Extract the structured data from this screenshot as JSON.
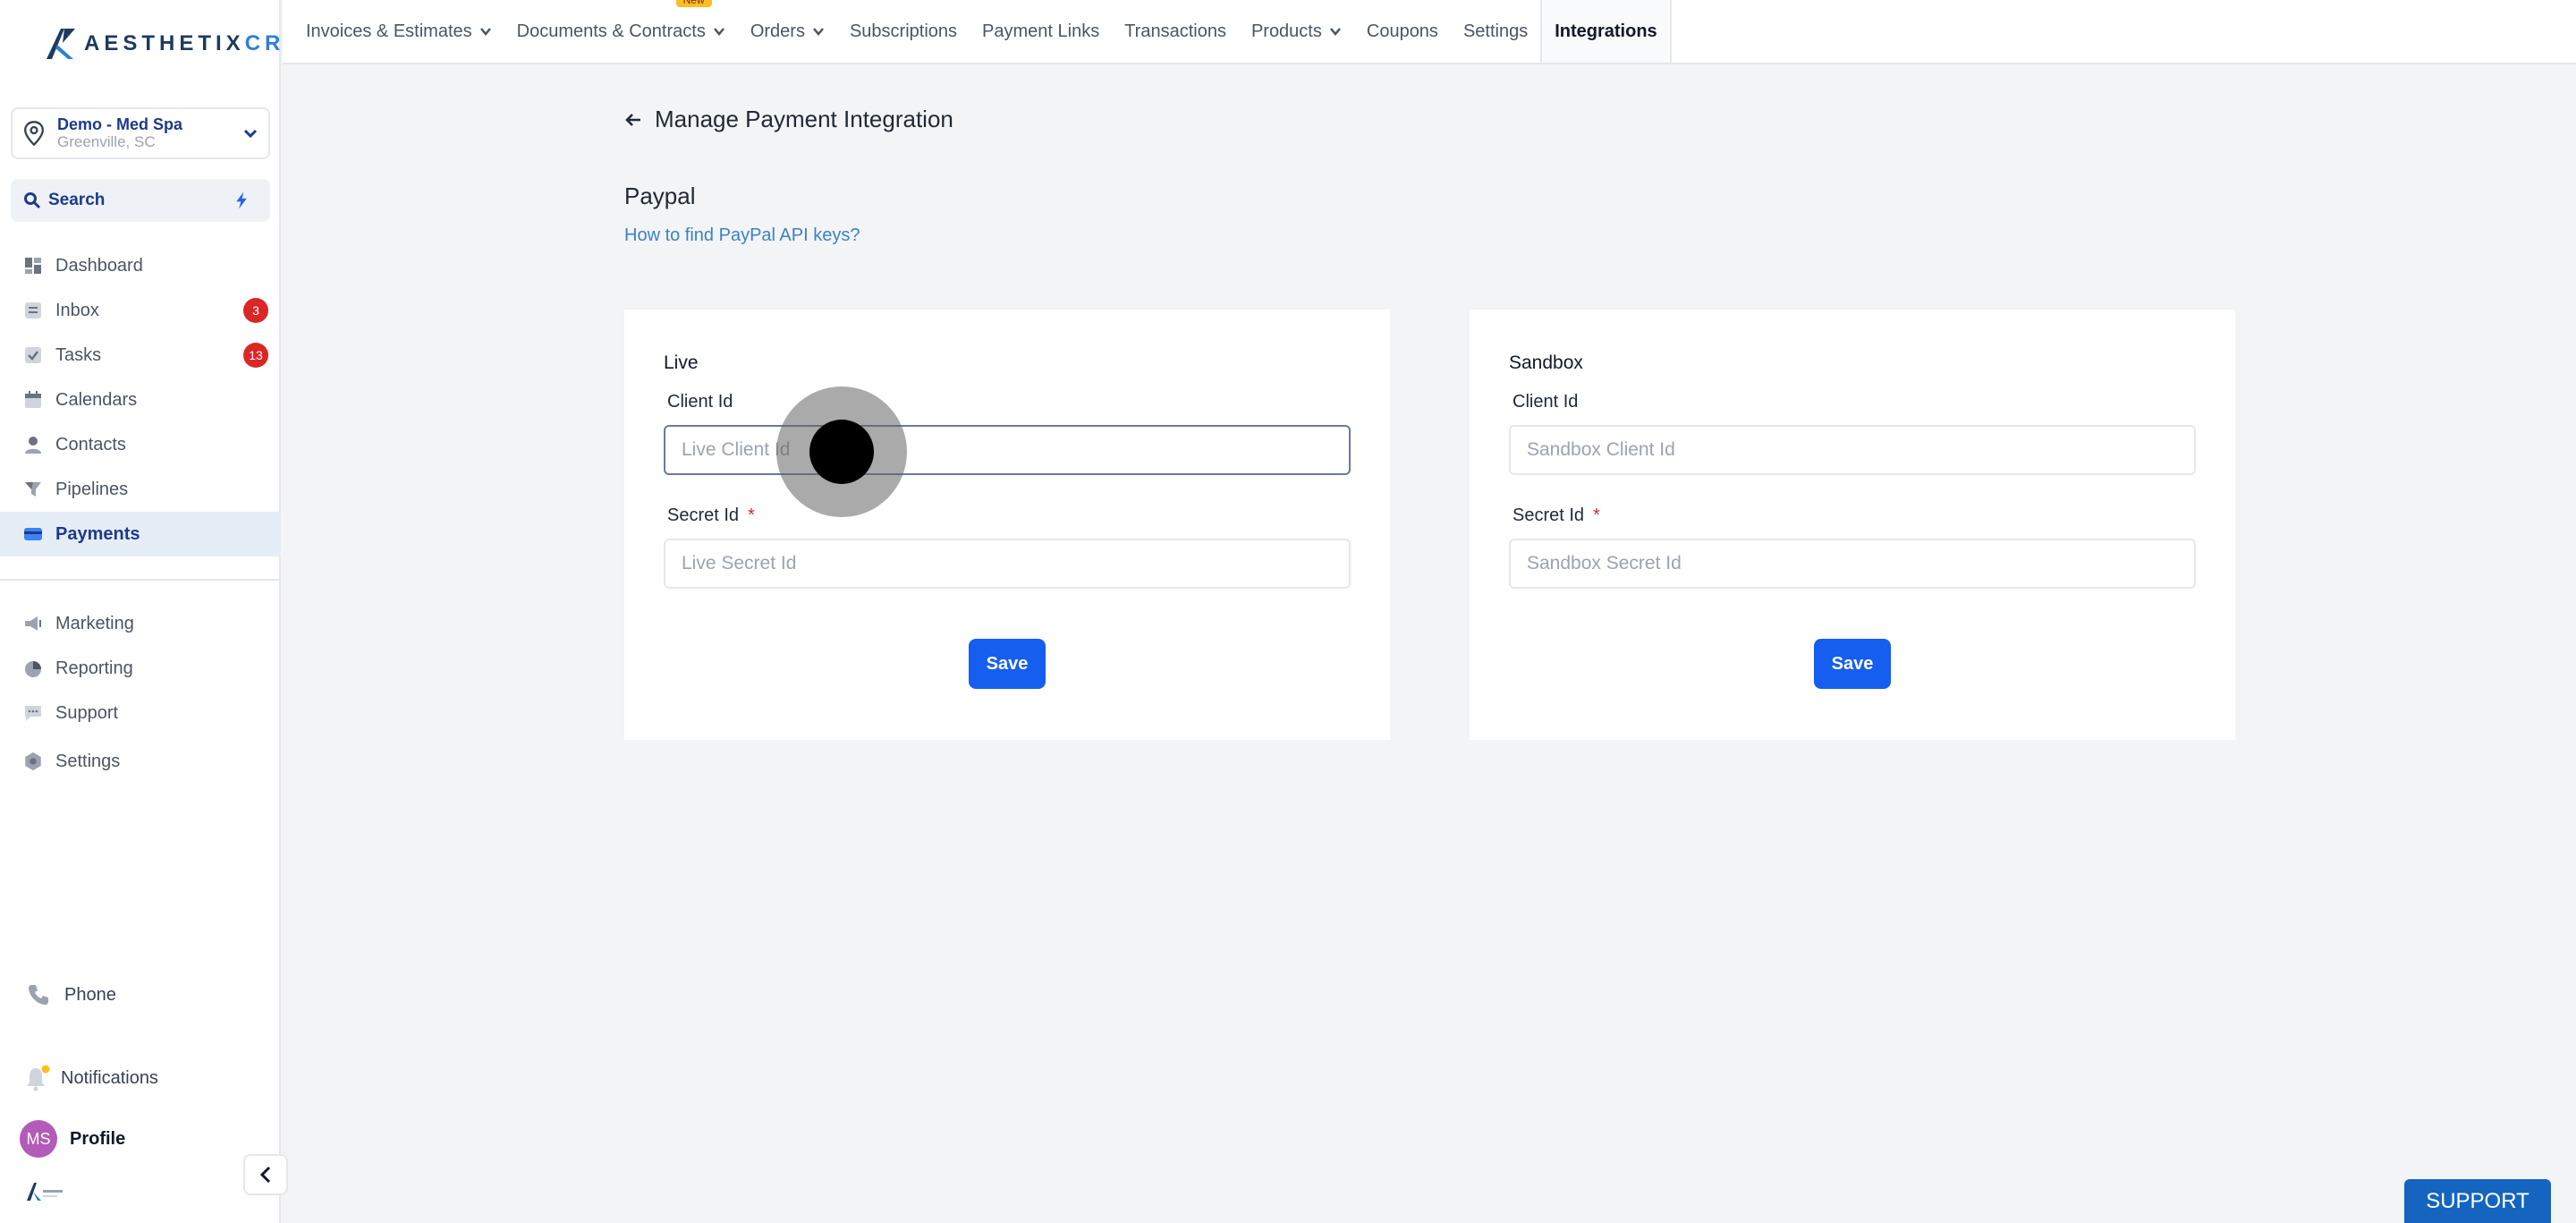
{
  "brand": {
    "name_part1": "AESTHETIX",
    "name_part2": "CRM"
  },
  "location": {
    "name": "Demo - Med Spa",
    "city": "Greenville, SC"
  },
  "search": {
    "label": "Search"
  },
  "sidebar": {
    "items": [
      {
        "label": "Dashboard",
        "icon": "dashboard-icon"
      },
      {
        "label": "Inbox",
        "icon": "inbox-icon",
        "badge": "3"
      },
      {
        "label": "Tasks",
        "icon": "tasks-icon",
        "badge": "13"
      },
      {
        "label": "Calendars",
        "icon": "calendar-icon"
      },
      {
        "label": "Contacts",
        "icon": "contacts-icon"
      },
      {
        "label": "Pipelines",
        "icon": "pipelines-icon"
      },
      {
        "label": "Payments",
        "icon": "payments-icon",
        "active": true
      }
    ],
    "items2": [
      {
        "label": "Marketing",
        "icon": "marketing-icon"
      },
      {
        "label": "Reporting",
        "icon": "reporting-icon"
      },
      {
        "label": "Support",
        "icon": "support-icon"
      },
      {
        "label": "Settings",
        "icon": "settings-icon"
      }
    ],
    "phone": "Phone",
    "notifications": "Notifications",
    "profile": {
      "initials": "MS",
      "label": "Profile"
    }
  },
  "topnav": {
    "new_badge": "New",
    "tabs": [
      {
        "label": "Invoices & Estimates",
        "dropdown": true
      },
      {
        "label": "Documents & Contracts",
        "dropdown": true
      },
      {
        "label": "Orders",
        "dropdown": true
      },
      {
        "label": "Subscriptions"
      },
      {
        "label": "Payment Links"
      },
      {
        "label": "Transactions"
      },
      {
        "label": "Products",
        "dropdown": true
      },
      {
        "label": "Coupons"
      },
      {
        "label": "Settings"
      },
      {
        "label": "Integrations",
        "active": true
      }
    ]
  },
  "page": {
    "back_title": "Manage Payment Integration",
    "provider": "Paypal",
    "help_link": "How to find PayPal API keys?"
  },
  "live": {
    "title": "Live",
    "client_label": "Client Id",
    "client_placeholder": "Live Client Id",
    "secret_label": "Secret Id",
    "secret_placeholder": "Live Secret Id",
    "save": "Save"
  },
  "sandbox": {
    "title": "Sandbox",
    "client_label": "Client Id",
    "client_placeholder": "Sandbox Client Id",
    "secret_label": "Secret Id",
    "secret_placeholder": "Sandbox Secret Id",
    "save": "Save"
  },
  "required_mark": "*",
  "support_button": "SUPPORT",
  "colors": {
    "primary": "#155eef",
    "link": "#3b82c4",
    "badge": "#dc2626",
    "brand_dark": "#1e3a5f"
  }
}
